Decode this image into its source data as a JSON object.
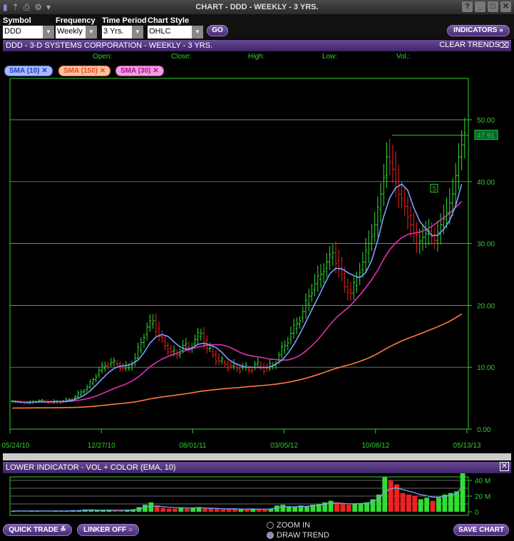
{
  "window": {
    "title": "CHART - DDD - WEEKLY - 3 YRS."
  },
  "controls": {
    "symbol": {
      "label": "Symbol",
      "value": "DDD"
    },
    "frequency": {
      "label": "Frequency",
      "value": "Weekly"
    },
    "period": {
      "label": "Time Period",
      "value": "3 Yrs."
    },
    "style": {
      "label": "Chart Style",
      "value": "OHLC"
    },
    "go": "GO",
    "indicators": "INDICATORS »"
  },
  "chart_header": {
    "title": "DDD - 3-D SYSTEMS CORPORATION - WEEKLY - 3 YRS.",
    "clear": "CLEAR TRENDS"
  },
  "readout": {
    "open": "Open:",
    "close": "Close:",
    "high": "High:",
    "low": "Low:",
    "vol": "Vol.:"
  },
  "chips": [
    {
      "label": "SMA (10)",
      "color": "#7aa0ff"
    },
    {
      "label": "SMA (150)",
      "color": "#ff7a40"
    },
    {
      "label": "SMA (30)",
      "color": "#e030b0"
    }
  ],
  "lower": {
    "title": "LOWER INDICATOR - VOL + COLOR (EMA, 10)"
  },
  "footer": {
    "quick_trade": "QUICK TRADE",
    "linker": "LINKER OFF",
    "zoom_in": "ZOOM IN",
    "draw_trend": "DRAW TREND",
    "save": "SAVE CHART"
  },
  "chart_data": {
    "type": "ohlc",
    "x_ticks": [
      "05/24/10",
      "12/27/10",
      "08/01/11",
      "03/05/12",
      "10/08/12",
      "05/13/13"
    ],
    "y_ticks": [
      "0.00",
      "10.00",
      "20.00",
      "30.00",
      "40.00",
      "50.00"
    ],
    "ylim": [
      0,
      55
    ],
    "last_price": "47.91",
    "trend_marker": "S",
    "closes": [
      4.5,
      4.3,
      4.2,
      4.4,
      4.6,
      4.5,
      4.3,
      4.4,
      4.5,
      4.8,
      5.2,
      6.0,
      6.8,
      8.0,
      9.5,
      10.2,
      10.8,
      10.5,
      9.8,
      10.0,
      11.5,
      14.0,
      16.5,
      17.5,
      15.0,
      13.5,
      12.5,
      12.0,
      13.5,
      13.0,
      14.5,
      15.5,
      13.0,
      12.0,
      11.0,
      10.5,
      10.2,
      9.8,
      10.0,
      9.5,
      10.5,
      10.0,
      9.8,
      10.3,
      12.0,
      13.5,
      15.5,
      17.0,
      19.0,
      21.5,
      23.5,
      25.0,
      27.0,
      28.5,
      26.0,
      23.0,
      22.0,
      24.5,
      27.0,
      30.0,
      33.0,
      38.0,
      44.0,
      42.0,
      38.0,
      36.0,
      33.0,
      30.0,
      31.0,
      32.0,
      30.5,
      33.0,
      35.0,
      38.0,
      44.0,
      47.9
    ],
    "volume_ticks": [
      "0",
      "20 M",
      "40 M"
    ],
    "volume_m": [
      1,
      1,
      1,
      1,
      1,
      1,
      1,
      1,
      1,
      1,
      2,
      2,
      3,
      3,
      2,
      2,
      2,
      2,
      2,
      2,
      3,
      6,
      9,
      12,
      8,
      5,
      4,
      4,
      5,
      4,
      5,
      6,
      4,
      4,
      4,
      3,
      3,
      4,
      3,
      3,
      4,
      3,
      3,
      4,
      8,
      9,
      7,
      6,
      8,
      7,
      9,
      10,
      12,
      14,
      12,
      10,
      9,
      10,
      11,
      12,
      16,
      22,
      44,
      40,
      35,
      24,
      22,
      20,
      16,
      18,
      14,
      18,
      22,
      24,
      26,
      50
    ]
  }
}
